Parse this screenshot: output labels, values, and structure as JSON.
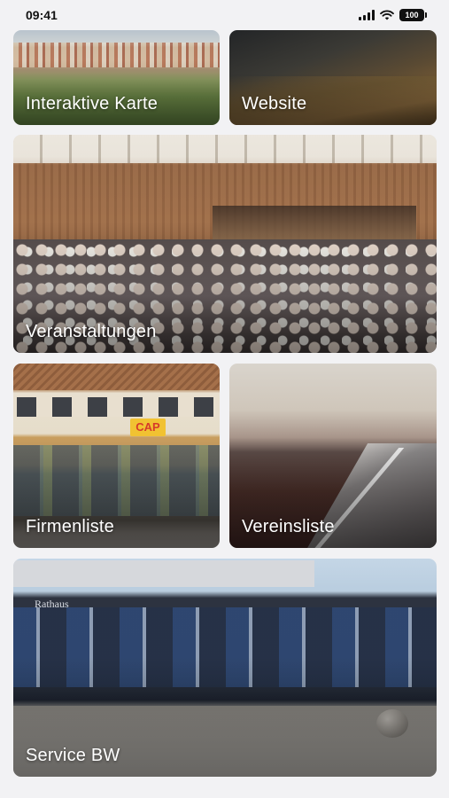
{
  "status_bar": {
    "time": "09:41",
    "battery": "100",
    "icons": [
      "signal-icon",
      "wifi-icon",
      "battery-icon"
    ]
  },
  "tiles": [
    {
      "id": "karte",
      "label": "Interaktive Karte"
    },
    {
      "id": "website",
      "label": "Website"
    },
    {
      "id": "events",
      "label": "Veranstaltungen"
    },
    {
      "id": "firmen",
      "label": "Firmenliste",
      "sign_text": "CAP"
    },
    {
      "id": "vereins",
      "label": "Vereinsliste"
    },
    {
      "id": "service",
      "label": "Service BW",
      "building_text": "Rathaus"
    }
  ],
  "colors": {
    "background": "#f2f2f4",
    "label_text": "#ffffff"
  }
}
